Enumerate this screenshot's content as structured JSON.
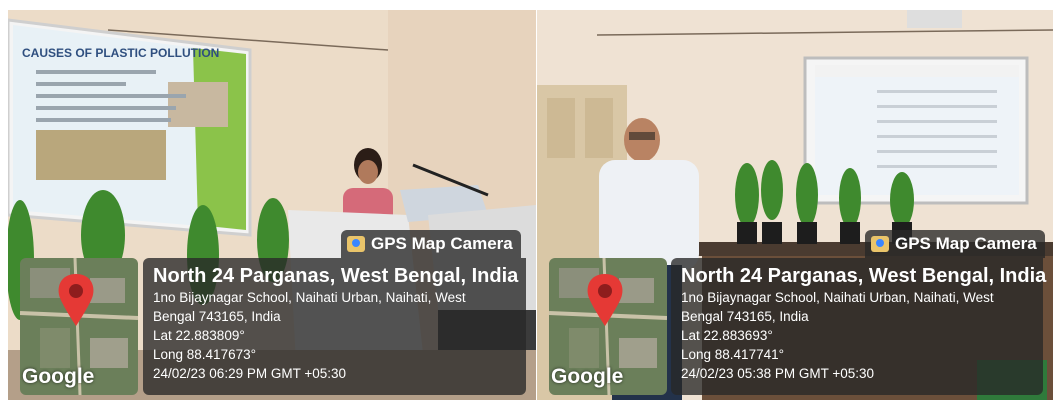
{
  "photos": [
    {
      "badge_label": "GPS Map Camera",
      "map_label": "Google",
      "location_title": "North 24 Parganas, West Bengal, India",
      "address_line1": "1no Bijaynagar School, Naihati Urban, Naihati, West",
      "address_line2": "Bengal 743165, India",
      "lat": "Lat 22.883809°",
      "long": "Long 88.417673°",
      "datetime": "24/02/23 06:29 PM GMT +05:30",
      "slide_title": "CAUSES OF PLASTIC POLLUTION"
    },
    {
      "badge_label": "GPS Map Camera",
      "map_label": "Google",
      "location_title": "North 24 Parganas, West Bengal, India",
      "address_line1": "1no Bijaynagar School, Naihati Urban, Naihati, West",
      "address_line2": "Bengal 743165, India",
      "lat": "Lat 22.883693°",
      "long": "Long 88.417741°",
      "datetime": "24/02/23 05:38 PM GMT +05:30"
    }
  ],
  "colors": {
    "overlay": "#282828",
    "pin": "#e53935",
    "wall": "#efe2d3"
  }
}
